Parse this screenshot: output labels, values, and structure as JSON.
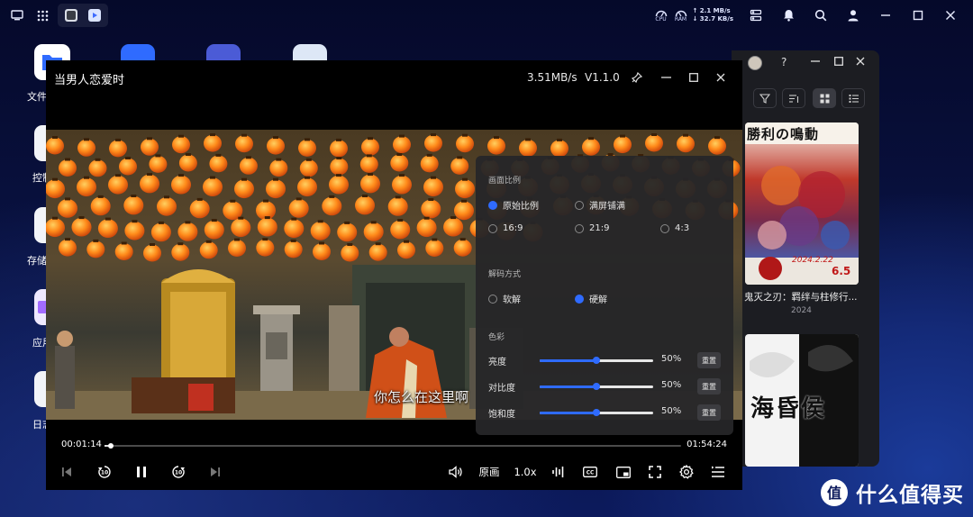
{
  "player": {
    "title": "当男人恋爱时",
    "speed_indicator": "3.51MB/s",
    "version": "V1.1.0",
    "subtitle": "你怎么在这里啊",
    "time_current": "00:01:14",
    "time_total": "01:54:24",
    "progress": 0.011,
    "quality_label": "原画",
    "rate_label": "1.0x"
  },
  "settings": {
    "aspect_title": "画面比例",
    "aspect_options": [
      "原始比例",
      "满屏铺满",
      "16:9",
      "21:9",
      "4:3"
    ],
    "aspect_selected": "原始比例",
    "decode_title": "解码方式",
    "decode_options": [
      "软解",
      "硬解"
    ],
    "decode_selected": "硬解",
    "color_title": "色彩",
    "color_rows": [
      {
        "label": "亮度",
        "value": "50%",
        "level": 0.5
      },
      {
        "label": "对比度",
        "value": "50%",
        "level": 0.5
      },
      {
        "label": "饱和度",
        "value": "50%",
        "level": 0.5
      }
    ],
    "reset_label": "重置",
    "accent_color": "#2f6bff"
  },
  "taskbar": {
    "cpu_label": "CPU",
    "ram_label": "RAM",
    "upload": "↑ 2.1 MB/s",
    "download": "↓ 32.7 KB/s"
  },
  "desktop": {
    "icon_labels": [
      "文件",
      "控制",
      "存储",
      "应用",
      "日志"
    ]
  },
  "library": {
    "poster1_title": "鬼灭之刃：羁绊与柱修行...",
    "poster1_year": "2024",
    "poster1_art_text": "勝利の鳴動",
    "poster1_art_date": "2024.2.22",
    "poster1_art_num": "6.5",
    "poster2_art_text": "海昏侯"
  },
  "watermark": {
    "text": "什么值得买",
    "badge": "值"
  }
}
